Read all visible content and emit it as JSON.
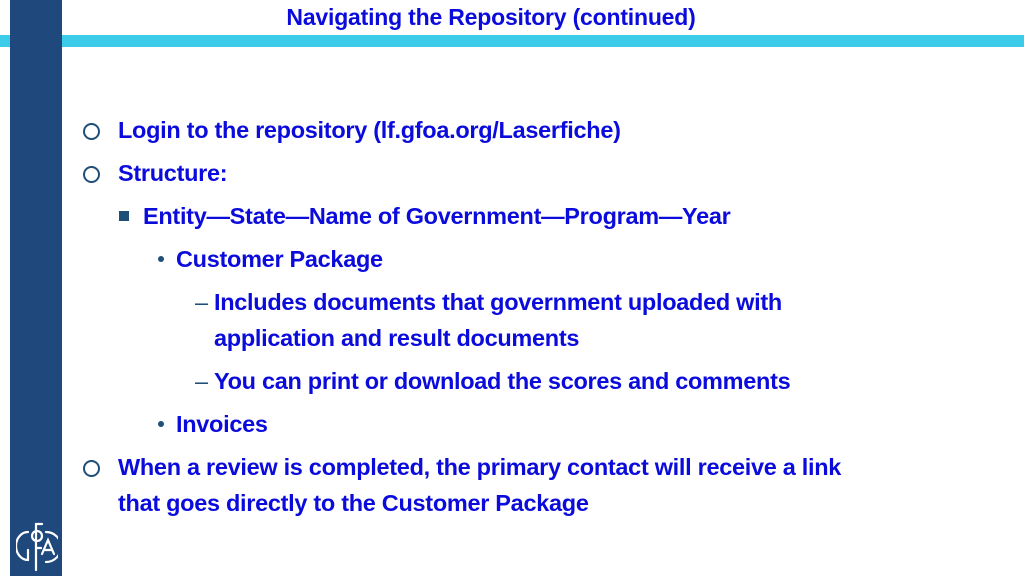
{
  "slide": {
    "title": "Navigating the Repository (continued)",
    "colors": {
      "text": "#0b0bdc",
      "sidebar": "#1f497d",
      "band": "#3ccbe8",
      "bullet": "#1f4e79"
    },
    "logo": {
      "icon": "gfoa-logo-icon",
      "text": "GFOA"
    },
    "bullets": [
      {
        "level": 1,
        "marker": "circle",
        "text": "Login to the repository (lf.gfoa.org/Laserfiche)"
      },
      {
        "level": 1,
        "marker": "circle",
        "text": "Structure:"
      },
      {
        "level": 2,
        "marker": "square",
        "text": "Entity—State—Name of Government—Program—Year"
      },
      {
        "level": 3,
        "marker": "dot",
        "text": "Customer Package"
      },
      {
        "level": 4,
        "marker": "dash",
        "text": "Includes documents that government uploaded with application and result documents",
        "lines": [
          "Includes documents that government uploaded with",
          "application and result documents"
        ]
      },
      {
        "level": 4,
        "marker": "dash",
        "text": "You can print or download the scores and comments"
      },
      {
        "level": 3,
        "marker": "dot",
        "text": "Invoices"
      },
      {
        "level": 1,
        "marker": "circle",
        "text": "When a review is completed, the primary contact will receive a link that goes directly to the Customer Package",
        "lines": [
          "When a review is completed, the primary contact will receive a link",
          "that goes directly to the Customer Package"
        ]
      }
    ],
    "dash_glyph": "–"
  }
}
